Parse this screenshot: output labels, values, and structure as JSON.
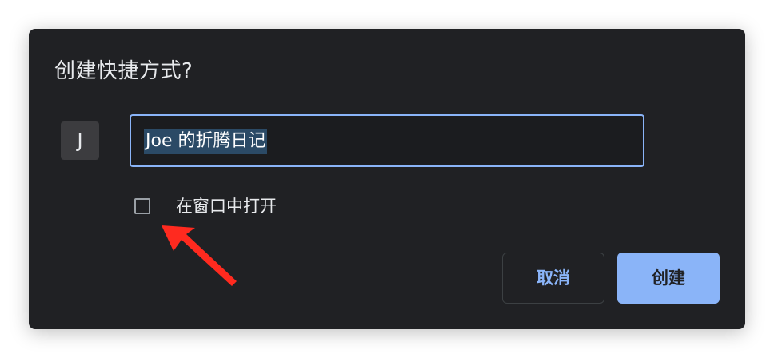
{
  "dialog": {
    "title": "创建快捷方式?",
    "site_icon_letter": "J",
    "name_input_value": "Joe 的折腾日记",
    "open_in_window_label": "在窗口中打开",
    "open_in_window_checked": false,
    "cancel_label": "取消",
    "create_label": "创建"
  },
  "colors": {
    "dialog_bg": "#202124",
    "accent": "#8ab4f8",
    "text": "#e8eaed",
    "selection": "#2b4a66",
    "annotation_arrow": "#ff2a1f"
  }
}
